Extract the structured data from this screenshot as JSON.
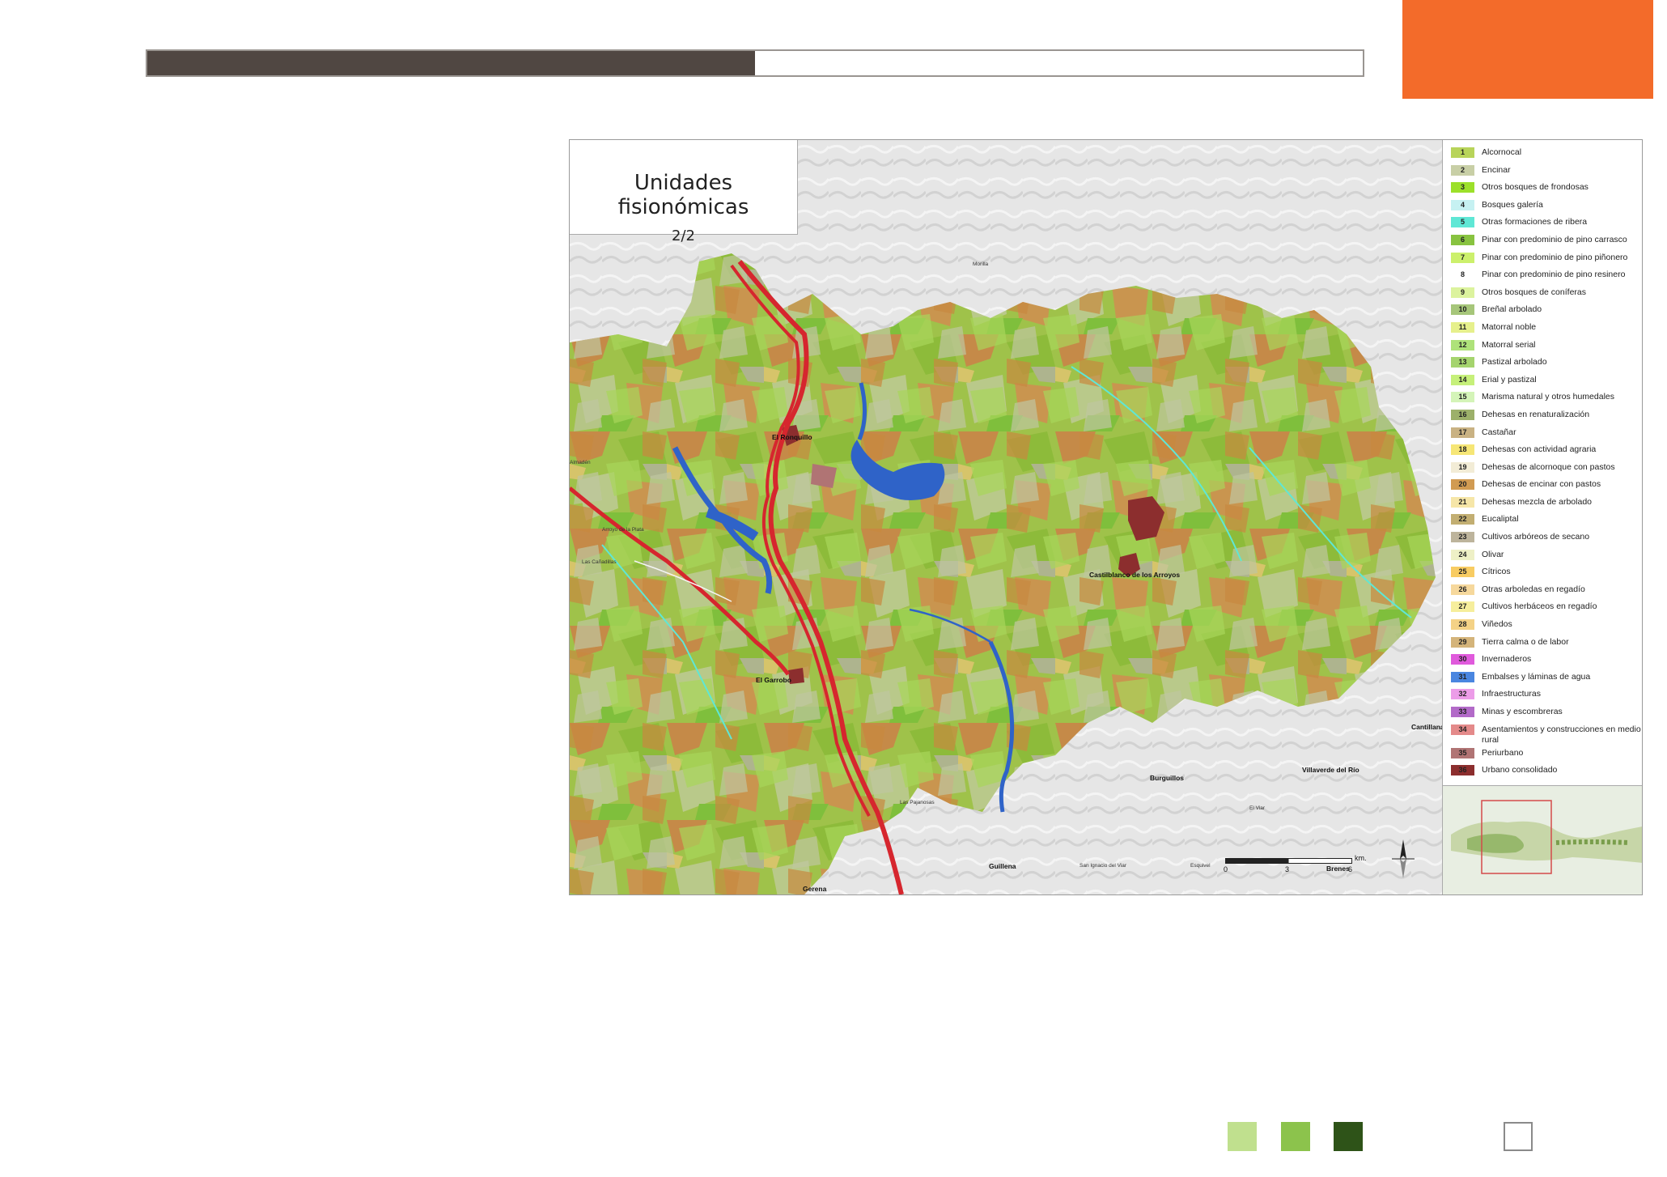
{
  "colors": {
    "header_fill": "#504742",
    "accent_orange": "#f36b2a",
    "square_light": "#c0e08e",
    "square_mid": "#8cc34c",
    "square_dark": "#2e5318",
    "water": "#2f63c8",
    "road": "#d6262e"
  },
  "header": {
    "progress_fraction": 0.5
  },
  "map": {
    "title": "Unidades fisionómicas",
    "subtitle": "2/2",
    "places": {
      "el_ronquillo": "El Ronquillo",
      "el_garrobo": "El Garrobo",
      "castilblanco": "Castilblanco de los Arroyos",
      "gerena": "Gerena",
      "guillena": "Guillena",
      "burguillos": "Burguillos",
      "villaverde": "Villaverde del Río",
      "cantillana": "Cantillana",
      "brenes": "Brenes",
      "las_pajanosas": "Las Pajanosas",
      "san_ignacio": "San Ignacio del Viar",
      "esquivel": "Esquivel",
      "el_viar": "El Viar",
      "las_canadillas": "Las Cañadillas",
      "la_pizarra": "Arroyo de la Plata",
      "almaden": "Almadén",
      "morilla": "Morilla"
    },
    "scale": {
      "zero": "0",
      "mid": "3",
      "end": "6",
      "unit": "km."
    }
  },
  "legend": [
    {
      "num": "1",
      "label": "Alcornocal",
      "color": "#b8d45a"
    },
    {
      "num": "2",
      "label": "Encinar",
      "color": "#c8cfa6"
    },
    {
      "num": "3",
      "label": "Otros bosques de frondosas",
      "color": "#9ce02a"
    },
    {
      "num": "4",
      "label": "Bosques galería",
      "color": "#c6f1f2"
    },
    {
      "num": "5",
      "label": "Otras formaciones de ribera",
      "color": "#5fe7d5"
    },
    {
      "num": "6",
      "label": "Pinar con predominio de pino carrasco",
      "color": "#88c340"
    },
    {
      "num": "7",
      "label": "Pinar con predominio de pino piñonero",
      "color": "#ccf06c"
    },
    {
      "num": "8",
      "label": "Pinar con predominio de pino resinero",
      "color": "#ffffff"
    },
    {
      "num": "9",
      "label": "Otros bosques de coníferas",
      "color": "#dcf39e"
    },
    {
      "num": "10",
      "label": "Breñal arbolado",
      "color": "#a6c67a"
    },
    {
      "num": "11",
      "label": "Matorral noble",
      "color": "#e6f08c"
    },
    {
      "num": "12",
      "label": "Matorral serial",
      "color": "#aee27a"
    },
    {
      "num": "13",
      "label": "Pastizal arbolado",
      "color": "#a5d46e"
    },
    {
      "num": "14",
      "label": "Erial y pastizal",
      "color": "#c6f07a"
    },
    {
      "num": "15",
      "label": "Marisma natural y otros humedales",
      "color": "#d4f4b8"
    },
    {
      "num": "16",
      "label": "Dehesas en renaturalización",
      "color": "#9cb06a"
    },
    {
      "num": "17",
      "label": "Castañar",
      "color": "#c9b283"
    },
    {
      "num": "18",
      "label": "Dehesas con actividad agraria",
      "color": "#f6e676"
    },
    {
      "num": "19",
      "label": "Dehesas de alcornoque con pastos",
      "color": "#f2ecd6"
    },
    {
      "num": "20",
      "label": "Dehesas de encinar con pastos",
      "color": "#d19b52"
    },
    {
      "num": "21",
      "label": "Dehesas mezcla de arbolado",
      "color": "#f6e6a8"
    },
    {
      "num": "22",
      "label": "Eucaliptal",
      "color": "#c2ae72"
    },
    {
      "num": "23",
      "label": "Cultivos arbóreos de secano",
      "color": "#bdb49c"
    },
    {
      "num": "24",
      "label": "Olivar",
      "color": "#eef0c6"
    },
    {
      "num": "25",
      "label": "Cítricos",
      "color": "#f8cc62"
    },
    {
      "num": "26",
      "label": "Otras arboledas en regadío",
      "color": "#f6d89c"
    },
    {
      "num": "27",
      "label": "Cultivos herbáceos en regadío",
      "color": "#f6ee9c"
    },
    {
      "num": "28",
      "label": "Viñedos",
      "color": "#f4d286"
    },
    {
      "num": "29",
      "label": "Tierra calma o de labor",
      "color": "#d4b47a"
    },
    {
      "num": "30",
      "label": "Invernaderos",
      "color": "#e05adc"
    },
    {
      "num": "31",
      "label": "Embalses y láminas de agua",
      "color": "#4a86e0"
    },
    {
      "num": "32",
      "label": "Infraestructuras",
      "color": "#ec9ce8"
    },
    {
      "num": "33",
      "label": "Minas y escombreras",
      "color": "#b26ac8"
    },
    {
      "num": "34",
      "label": "Asentamientos y construcciones en medio rural",
      "color": "#e48a8a"
    },
    {
      "num": "35",
      "label": "Periurbano",
      "color": "#b07474"
    },
    {
      "num": "36",
      "label": "Urbano consolidado",
      "color": "#8c2e2e"
    }
  ]
}
